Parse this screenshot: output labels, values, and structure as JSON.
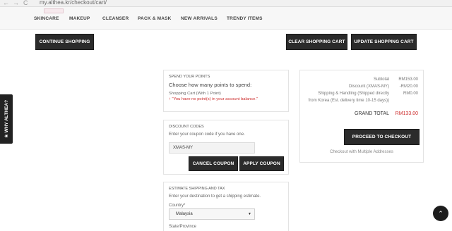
{
  "browser": {
    "back_glyph": "←",
    "forward_glyph": "→",
    "reload_glyph": "C",
    "url": "my.althea.kr/checkout/cart/"
  },
  "nav": {
    "items": [
      "SKINCARE",
      "MAKEUP",
      "CLEANSER",
      "PACK & MASK",
      "NEW ARRIVALS",
      "TRENDY ITEMS"
    ]
  },
  "actions": {
    "continue_shopping": "CONTINUE SHOPPING",
    "clear_cart": "CLEAR SHOPPING CART",
    "update_cart": "UPDATE SHOPPING CART"
  },
  "points": {
    "title": "SPEND YOUR POINTS",
    "heading": "Choose how many points to spend:",
    "cart_line": "Shopping Cart (With 1 Point)",
    "error_icon": "↑",
    "error": "You have no point(s) in your account balance."
  },
  "discount": {
    "title": "DISCOUNT CODES",
    "prompt": "Enter your coupon code if you have one.",
    "code_value": "XMAS-MY",
    "cancel_label": "CANCEL COUPON",
    "apply_label": "APPLY COUPON"
  },
  "shipping": {
    "title": "ESTIMATE SHIPPING AND TAX",
    "prompt": "Enter your destination to get a shipping estimate.",
    "country_label": "Country*",
    "country_value": "Malaysia",
    "state_label": "State/Province"
  },
  "totals": {
    "subtotal_label": "Subtotal",
    "subtotal_value": "RM153.00",
    "discount_label": "Discount (XMAS-MY)",
    "discount_value": "-RM20.00",
    "shipping_label_1": "Shipping & Handling (Shipped directly",
    "shipping_label_2": "from Korea (Est. delivery time 10-15 days))",
    "shipping_value": "RM0.00",
    "grand_label": "GRAND TOTAL",
    "grand_value": "RM133.00",
    "checkout_label": "PROCEED TO CHECKOUT",
    "multi_label": "Checkout with Multiple Addresses"
  },
  "side_tab": {
    "label": "★ WHY ALTHEA?"
  },
  "scroll_top_glyph": "⌃",
  "colors": {
    "accent_red": "#cc2a2a",
    "dark_button": "#2b2b2b"
  }
}
